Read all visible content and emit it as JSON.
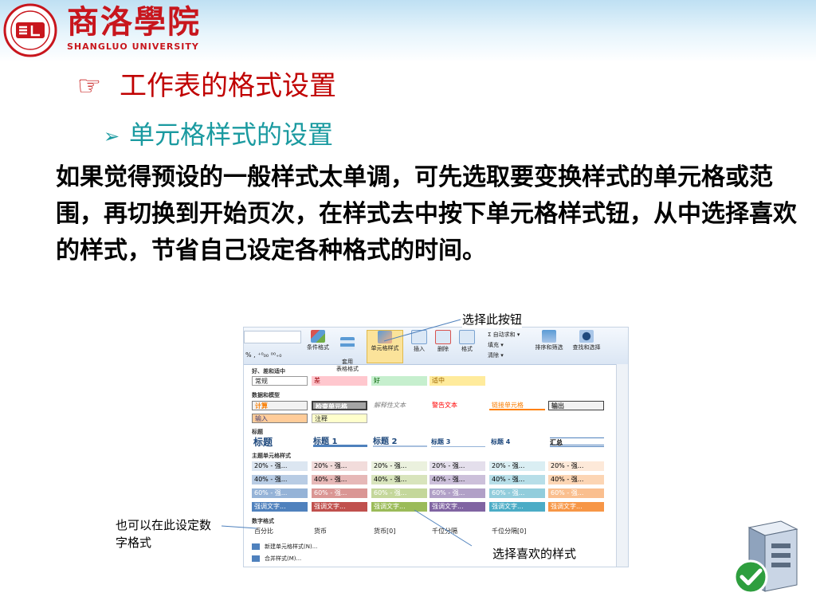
{
  "header": {
    "school_cn": "商洛學院",
    "school_en": "SHANGLUO UNIVERSITY"
  },
  "title1": "工作表的格式设置",
  "title2": "单元格样式的设置",
  "paragraph": "如果觉得预设的一般样式太单调，可先选取要变换样式的单元格或范围，再切换到开始页次，在样式去中按下单元格样式钮，从中选择喜欢的样式，节省自己设定各种格式的时间。",
  "callouts": {
    "button": "选择此按钮",
    "number_format": "也可以在此设定数字格式",
    "favorite": "选择喜欢的样式"
  },
  "ribbon": {
    "number_row": "% ,  ⁺⁰₀₀ ⁰⁰₊₀",
    "buttons": {
      "conditional": "条件格式",
      "table": "套用\n表格格式",
      "cell_styles": "单元格样式",
      "insert": "插入",
      "delete": "删除",
      "format": "格式",
      "sort": "排序和筛选",
      "find": "查找和选择"
    },
    "small": {
      "autosum": "Σ 自动求和 ▾",
      "fill": "填充 ▾",
      "clear": "清除 ▾"
    },
    "sections": {
      "good_bad": "好、差和适中",
      "data_model": "数据和模型",
      "titles": "标题",
      "theme": "主题单元格样式",
      "number": "数字格式"
    },
    "good_bad": [
      "常规",
      "差",
      "好",
      "适中"
    ],
    "data_model_row1": [
      "计算",
      "检查单元格",
      "解释性文本",
      "警告文本",
      "链接单元格",
      "输出"
    ],
    "data_model_row2": [
      "输入",
      "注释"
    ],
    "titles": [
      "标题",
      "标题 1",
      "标题 2",
      "标题 3",
      "标题 4",
      "汇总"
    ],
    "theme_rows": [
      [
        "20% - 强...",
        "20% - 强...",
        "20% - 强...",
        "20% - 强...",
        "20% - 强...",
        "20% - 强..."
      ],
      [
        "40% - 强...",
        "40% - 强...",
        "40% - 强...",
        "40% - 强...",
        "40% - 强...",
        "40% - 强..."
      ],
      [
        "60% - 强...",
        "60% - 强...",
        "60% - 强...",
        "60% - 强...",
        "60% - 强...",
        "60% - 强..."
      ],
      [
        "强调文字...",
        "强调文字...",
        "强调文字...",
        "强调文字...",
        "强调文字...",
        "强调文字..."
      ]
    ],
    "number_formats": [
      "百分比",
      "货币",
      "货币[0]",
      "千位分隔",
      "千位分隔[0]"
    ],
    "menu": [
      "新建单元格样式(N)...",
      "合并样式(M)..."
    ]
  },
  "colors": {
    "title1": "#c00000",
    "title2": "#1a9aa0",
    "brand_red": "#c8161d"
  }
}
